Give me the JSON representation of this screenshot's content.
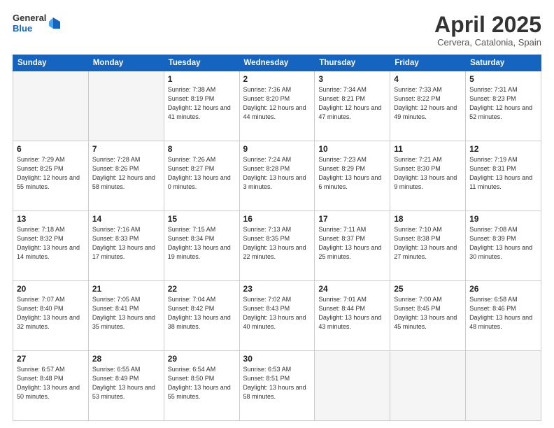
{
  "logo": {
    "general": "General",
    "blue": "Blue"
  },
  "header": {
    "month": "April 2025",
    "location": "Cervera, Catalonia, Spain"
  },
  "weekdays": [
    "Sunday",
    "Monday",
    "Tuesday",
    "Wednesday",
    "Thursday",
    "Friday",
    "Saturday"
  ],
  "weeks": [
    [
      {
        "day": "",
        "info": ""
      },
      {
        "day": "",
        "info": ""
      },
      {
        "day": "1",
        "info": "Sunrise: 7:38 AM\nSunset: 8:19 PM\nDaylight: 12 hours\nand 41 minutes."
      },
      {
        "day": "2",
        "info": "Sunrise: 7:36 AM\nSunset: 8:20 PM\nDaylight: 12 hours\nand 44 minutes."
      },
      {
        "day": "3",
        "info": "Sunrise: 7:34 AM\nSunset: 8:21 PM\nDaylight: 12 hours\nand 47 minutes."
      },
      {
        "day": "4",
        "info": "Sunrise: 7:33 AM\nSunset: 8:22 PM\nDaylight: 12 hours\nand 49 minutes."
      },
      {
        "day": "5",
        "info": "Sunrise: 7:31 AM\nSunset: 8:23 PM\nDaylight: 12 hours\nand 52 minutes."
      }
    ],
    [
      {
        "day": "6",
        "info": "Sunrise: 7:29 AM\nSunset: 8:25 PM\nDaylight: 12 hours\nand 55 minutes."
      },
      {
        "day": "7",
        "info": "Sunrise: 7:28 AM\nSunset: 8:26 PM\nDaylight: 12 hours\nand 58 minutes."
      },
      {
        "day": "8",
        "info": "Sunrise: 7:26 AM\nSunset: 8:27 PM\nDaylight: 13 hours\nand 0 minutes."
      },
      {
        "day": "9",
        "info": "Sunrise: 7:24 AM\nSunset: 8:28 PM\nDaylight: 13 hours\nand 3 minutes."
      },
      {
        "day": "10",
        "info": "Sunrise: 7:23 AM\nSunset: 8:29 PM\nDaylight: 13 hours\nand 6 minutes."
      },
      {
        "day": "11",
        "info": "Sunrise: 7:21 AM\nSunset: 8:30 PM\nDaylight: 13 hours\nand 9 minutes."
      },
      {
        "day": "12",
        "info": "Sunrise: 7:19 AM\nSunset: 8:31 PM\nDaylight: 13 hours\nand 11 minutes."
      }
    ],
    [
      {
        "day": "13",
        "info": "Sunrise: 7:18 AM\nSunset: 8:32 PM\nDaylight: 13 hours\nand 14 minutes."
      },
      {
        "day": "14",
        "info": "Sunrise: 7:16 AM\nSunset: 8:33 PM\nDaylight: 13 hours\nand 17 minutes."
      },
      {
        "day": "15",
        "info": "Sunrise: 7:15 AM\nSunset: 8:34 PM\nDaylight: 13 hours\nand 19 minutes."
      },
      {
        "day": "16",
        "info": "Sunrise: 7:13 AM\nSunset: 8:35 PM\nDaylight: 13 hours\nand 22 minutes."
      },
      {
        "day": "17",
        "info": "Sunrise: 7:11 AM\nSunset: 8:37 PM\nDaylight: 13 hours\nand 25 minutes."
      },
      {
        "day": "18",
        "info": "Sunrise: 7:10 AM\nSunset: 8:38 PM\nDaylight: 13 hours\nand 27 minutes."
      },
      {
        "day": "19",
        "info": "Sunrise: 7:08 AM\nSunset: 8:39 PM\nDaylight: 13 hours\nand 30 minutes."
      }
    ],
    [
      {
        "day": "20",
        "info": "Sunrise: 7:07 AM\nSunset: 8:40 PM\nDaylight: 13 hours\nand 32 minutes."
      },
      {
        "day": "21",
        "info": "Sunrise: 7:05 AM\nSunset: 8:41 PM\nDaylight: 13 hours\nand 35 minutes."
      },
      {
        "day": "22",
        "info": "Sunrise: 7:04 AM\nSunset: 8:42 PM\nDaylight: 13 hours\nand 38 minutes."
      },
      {
        "day": "23",
        "info": "Sunrise: 7:02 AM\nSunset: 8:43 PM\nDaylight: 13 hours\nand 40 minutes."
      },
      {
        "day": "24",
        "info": "Sunrise: 7:01 AM\nSunset: 8:44 PM\nDaylight: 13 hours\nand 43 minutes."
      },
      {
        "day": "25",
        "info": "Sunrise: 7:00 AM\nSunset: 8:45 PM\nDaylight: 13 hours\nand 45 minutes."
      },
      {
        "day": "26",
        "info": "Sunrise: 6:58 AM\nSunset: 8:46 PM\nDaylight: 13 hours\nand 48 minutes."
      }
    ],
    [
      {
        "day": "27",
        "info": "Sunrise: 6:57 AM\nSunset: 8:48 PM\nDaylight: 13 hours\nand 50 minutes."
      },
      {
        "day": "28",
        "info": "Sunrise: 6:55 AM\nSunset: 8:49 PM\nDaylight: 13 hours\nand 53 minutes."
      },
      {
        "day": "29",
        "info": "Sunrise: 6:54 AM\nSunset: 8:50 PM\nDaylight: 13 hours\nand 55 minutes."
      },
      {
        "day": "30",
        "info": "Sunrise: 6:53 AM\nSunset: 8:51 PM\nDaylight: 13 hours\nand 58 minutes."
      },
      {
        "day": "",
        "info": ""
      },
      {
        "day": "",
        "info": ""
      },
      {
        "day": "",
        "info": ""
      }
    ]
  ]
}
